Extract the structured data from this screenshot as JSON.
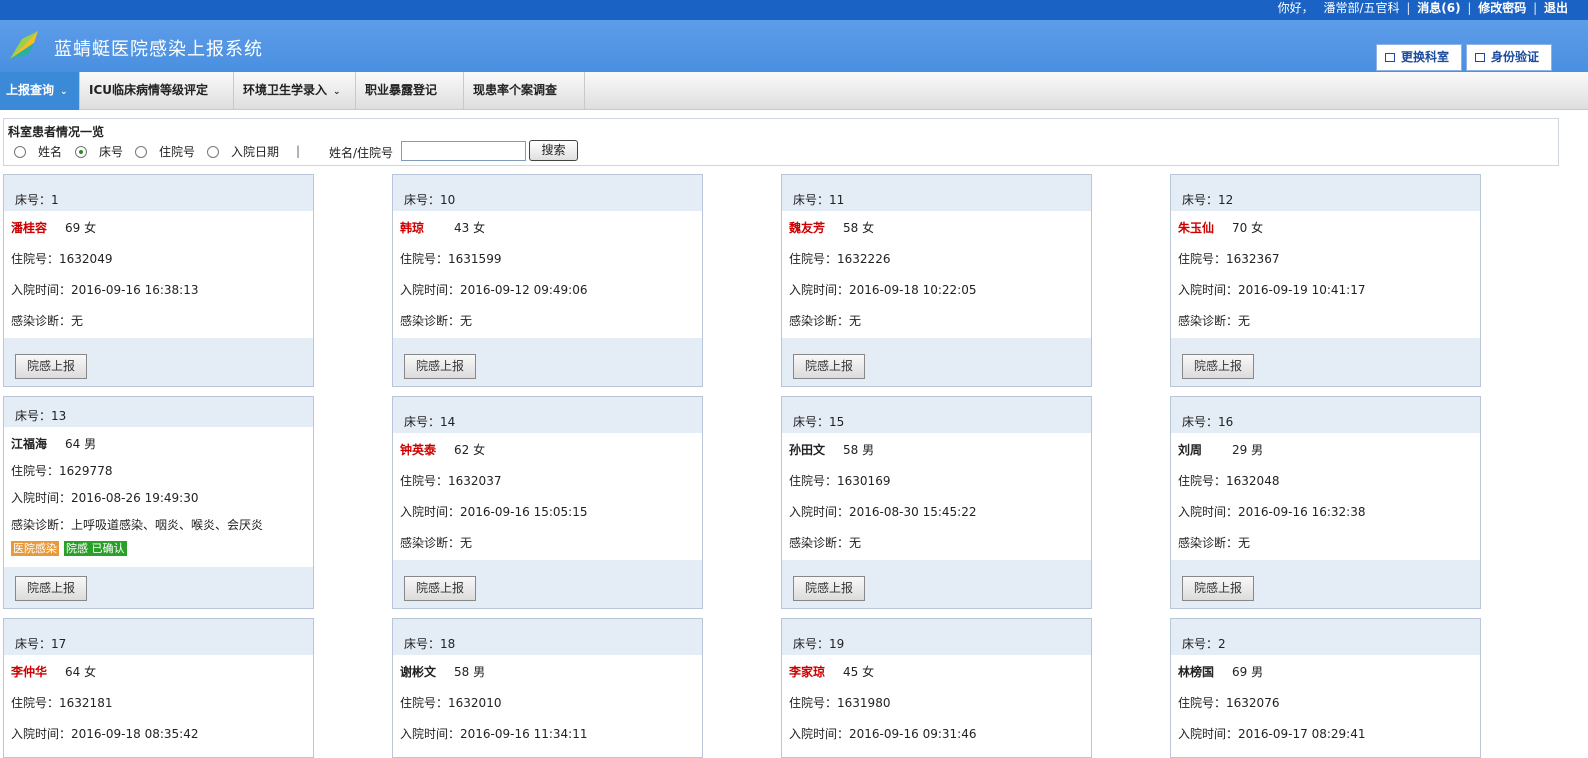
{
  "topbar": {
    "greeting": "你好，",
    "user": "潘常部/五官科",
    "messages": "消息(6)",
    "change_password": "修改密码",
    "logout": "退出"
  },
  "header": {
    "title": "蓝蜻蜓医院感染上报系统",
    "change_dept": "更换科室",
    "identity_verify": "身份验证"
  },
  "nav": {
    "items": [
      {
        "label": "上报查询",
        "active": true,
        "dropdown": true
      },
      {
        "label": "ICU临床病情等级评定",
        "active": false,
        "dropdown": false
      },
      {
        "label": "环境卫生学录入",
        "active": false,
        "dropdown": true
      },
      {
        "label": "职业暴露登记",
        "active": false,
        "dropdown": false
      },
      {
        "label": "现患率个案调查",
        "active": false,
        "dropdown": false
      }
    ]
  },
  "filter": {
    "title": "科室患者情况一览",
    "options": [
      {
        "label": "姓名",
        "checked": false
      },
      {
        "label": "床号",
        "checked": true
      },
      {
        "label": "住院号",
        "checked": false
      },
      {
        "label": "入院日期",
        "checked": false
      }
    ],
    "divider": "|",
    "search_label": "姓名/住院号",
    "search_value": "",
    "search_button": "搜索"
  },
  "labels": {
    "bed": "床号：",
    "inpatient_no": "住院号：",
    "admit_time": "入院时间：",
    "diagnosis": "感染诊断：",
    "report_button": "院感上报"
  },
  "patients": [
    {
      "bed": "1",
      "name": "潘桂容",
      "highlight": true,
      "age": "69",
      "sex": "女",
      "inpatient_no": "1632049",
      "admit_time": "2016-09-16 16:38:13",
      "diagnosis": "无"
    },
    {
      "bed": "10",
      "name": "韩琼",
      "highlight": true,
      "age": "43",
      "sex": "女",
      "inpatient_no": "1631599",
      "admit_time": "2016-09-12 09:49:06",
      "diagnosis": "无"
    },
    {
      "bed": "11",
      "name": "魏友芳",
      "highlight": true,
      "age": "58",
      "sex": "女",
      "inpatient_no": "1632226",
      "admit_time": "2016-09-18 10:22:05",
      "diagnosis": "无"
    },
    {
      "bed": "12",
      "name": "朱玉仙",
      "highlight": true,
      "age": "70",
      "sex": "女",
      "inpatient_no": "1632367",
      "admit_time": "2016-09-19 10:41:17",
      "diagnosis": "无"
    },
    {
      "bed": "13",
      "name": "江福海",
      "highlight": false,
      "age": "64",
      "sex": "男",
      "inpatient_no": "1629778",
      "admit_time": "2016-08-26 19:49:30",
      "diagnosis": "上呼吸道感染、咽炎、喉炎、会厌炎",
      "tags": [
        {
          "text": "医院感染",
          "color": "orange"
        },
        {
          "text": "院感 已确认",
          "color": "green"
        }
      ]
    },
    {
      "bed": "14",
      "name": "钟英泰",
      "highlight": true,
      "age": "62",
      "sex": "女",
      "inpatient_no": "1632037",
      "admit_time": "2016-09-16 15:05:15",
      "diagnosis": "无"
    },
    {
      "bed": "15",
      "name": "孙田文",
      "highlight": false,
      "age": "58",
      "sex": "男",
      "inpatient_no": "1630169",
      "admit_time": "2016-08-30 15:45:22",
      "diagnosis": "无"
    },
    {
      "bed": "16",
      "name": "刘周",
      "highlight": false,
      "age": "29",
      "sex": "男",
      "inpatient_no": "1632048",
      "admit_time": "2016-09-16 16:32:38",
      "diagnosis": "无"
    },
    {
      "bed": "17",
      "name": "李仲华",
      "highlight": true,
      "age": "64",
      "sex": "女",
      "inpatient_no": "1632181",
      "admit_time": "2016-09-18 08:35:42",
      "diagnosis": ""
    },
    {
      "bed": "18",
      "name": "谢彬文",
      "highlight": false,
      "age": "58",
      "sex": "男",
      "inpatient_no": "1632010",
      "admit_time": "2016-09-16 11:34:11",
      "diagnosis": ""
    },
    {
      "bed": "19",
      "name": "李家琼",
      "highlight": true,
      "age": "45",
      "sex": "女",
      "inpatient_no": "1631980",
      "admit_time": "2016-09-16 09:31:46",
      "diagnosis": ""
    },
    {
      "bed": "2",
      "name": "林榜国",
      "highlight": false,
      "age": "69",
      "sex": "男",
      "inpatient_no": "1632076",
      "admit_time": "2016-09-17 08:29:41",
      "diagnosis": ""
    }
  ]
}
